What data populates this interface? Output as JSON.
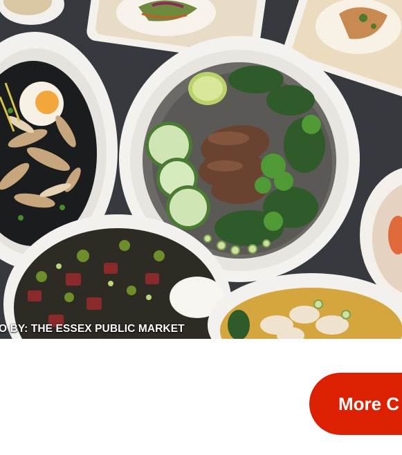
{
  "hero": {
    "credit_text": "O BY: THE ESSEX PUBLIC MARKET"
  },
  "cta": {
    "label": "More C"
  },
  "colors": {
    "button_bg": "#dd1f02",
    "button_text": "#ffffff",
    "table_bg": "#3a3d40"
  }
}
